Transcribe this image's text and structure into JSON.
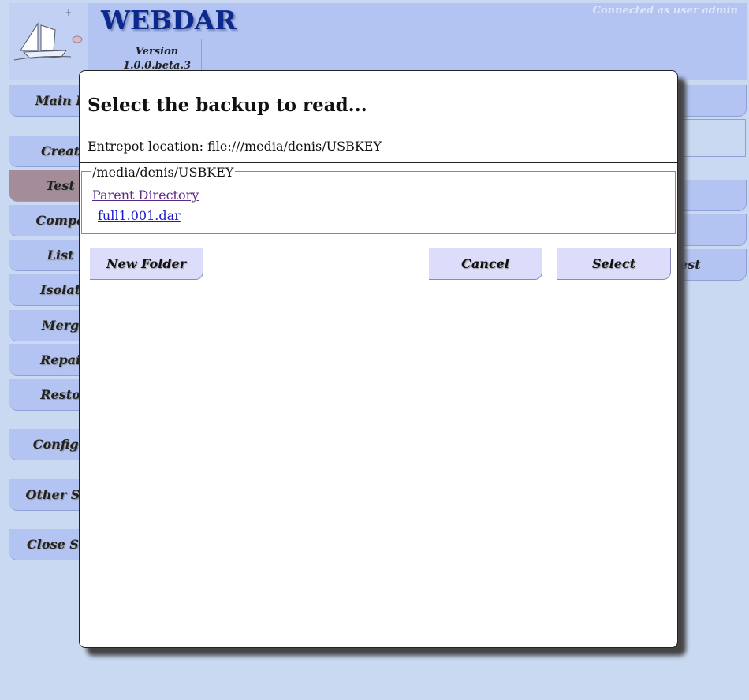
{
  "header": {
    "title": "WEBDAR",
    "version_label": "Version",
    "version_number": "1.0.0.beta.3",
    "connected": "Connected as user admin"
  },
  "menu": {
    "items": [
      {
        "label": "Main P",
        "active": false
      },
      {
        "label": "Creat",
        "active": false
      },
      {
        "label": "Test",
        "active": true
      },
      {
        "label": "Compa",
        "active": false
      },
      {
        "label": "List",
        "active": false
      },
      {
        "label": "Isolat",
        "active": false
      },
      {
        "label": "Merg",
        "active": false
      },
      {
        "label": "Repai",
        "active": false
      },
      {
        "label": "Resto",
        "active": false
      },
      {
        "label": "Configu",
        "active": false
      },
      {
        "label": "Other Ses",
        "active": false
      },
      {
        "label": "Close Ses",
        "active": false
      }
    ]
  },
  "right_panel": {
    "test_tab_label": "est"
  },
  "dialog": {
    "title": "Select the backup to read...",
    "entrepot_location": "Entrepot location: file:///media/denis/USBKEY",
    "current_path": "/media/denis/USBKEY",
    "parent_link": "Parent Directory",
    "files": [
      "full1.001.dar"
    ],
    "new_folder_label": "New Folder",
    "cancel_label": "Cancel",
    "select_label": "Select"
  },
  "colors": {
    "background": "#c9d9f2",
    "header": "#b3c4f2",
    "title": "#0b2a8c",
    "active_menu": "#a48c99",
    "dialog_button": "#dcdcfb"
  }
}
